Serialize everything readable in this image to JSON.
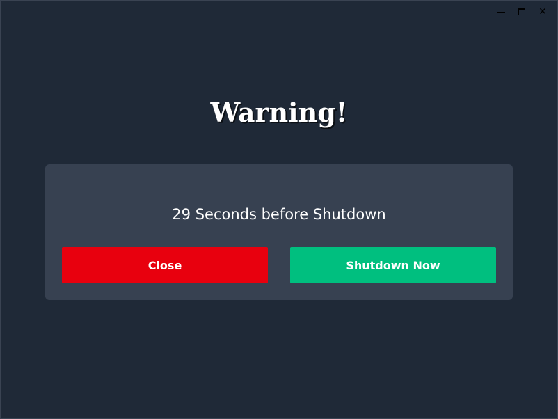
{
  "window": {
    "controls": {
      "minimize_icon": "minimize-icon",
      "maximize_icon": "maximize-icon",
      "close_glyph": "✕"
    }
  },
  "dialog": {
    "title": "Warning!",
    "message": "29 Seconds before Shutdown",
    "close_label": "Close",
    "shutdown_label": "Shutdown Now"
  },
  "colors": {
    "background": "#1f2937",
    "panel": "#374151",
    "close_button": "#e8000e",
    "shutdown_button": "#00bf7f",
    "text": "#ffffff"
  }
}
